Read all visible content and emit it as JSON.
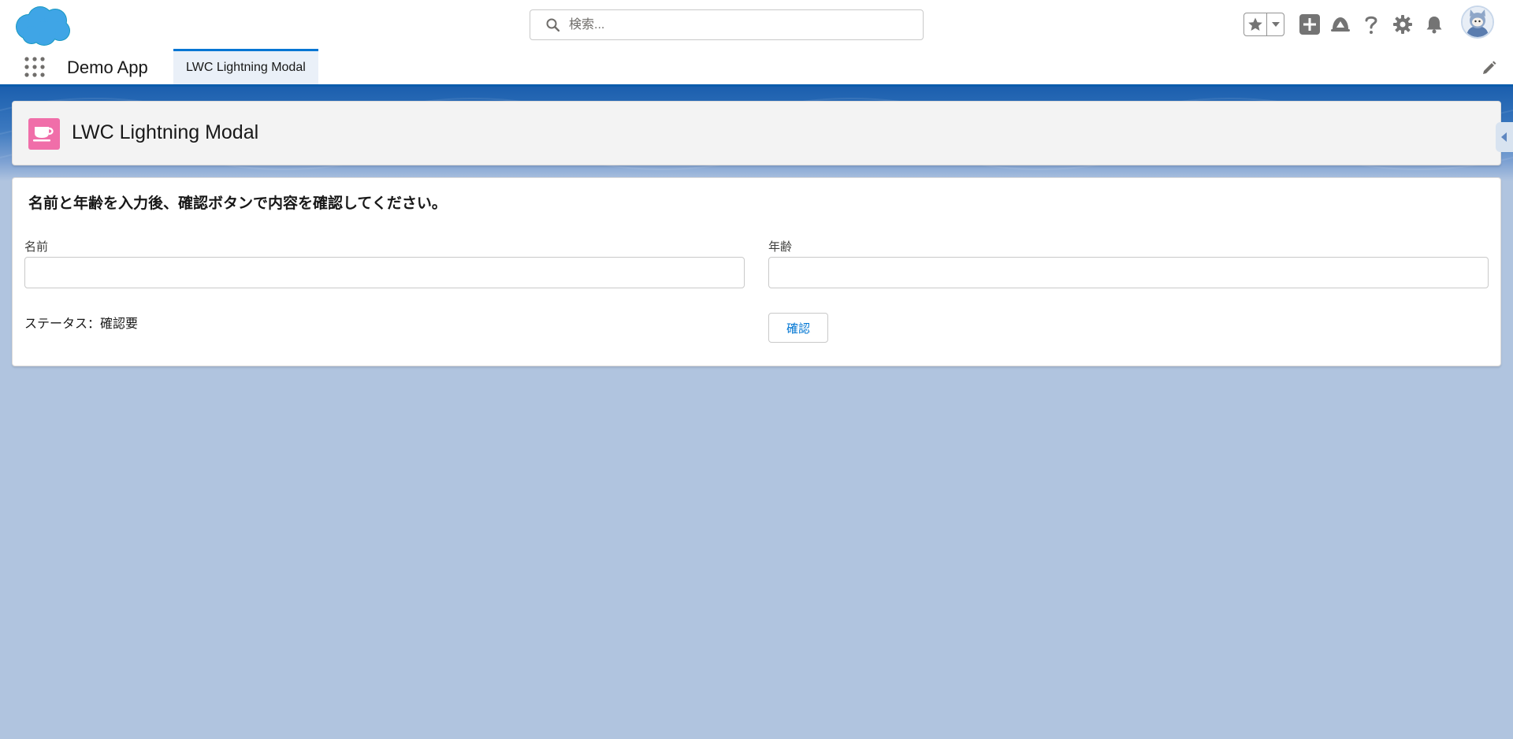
{
  "global_header": {
    "search": {
      "placeholder": "検索...",
      "value": ""
    },
    "icons": [
      "salesforce-cloud-logo",
      "star-icon",
      "chevron-down-icon",
      "add-icon",
      "trailhead-icon",
      "help-icon",
      "gear-icon",
      "bell-icon",
      "avatar"
    ]
  },
  "nav": {
    "app_name": "Demo App",
    "tabs": [
      {
        "label": "LWC Lightning Modal",
        "active": true
      }
    ]
  },
  "page_header": {
    "title": "LWC Lightning Modal",
    "icon": "cup-icon",
    "icon_color": "#f06ea9"
  },
  "form": {
    "instructions": "名前と年齢を入力後、確認ボタンで内容を確認してください。",
    "name_label": "名前",
    "name_value": "",
    "age_label": "年齢",
    "age_value": "",
    "status_text": "ステータス：確認要",
    "confirm_label": "確認"
  },
  "colors": {
    "brand_blue": "#0176d3",
    "nav_underline": "#0b5cab",
    "background": "#b0c4df"
  }
}
